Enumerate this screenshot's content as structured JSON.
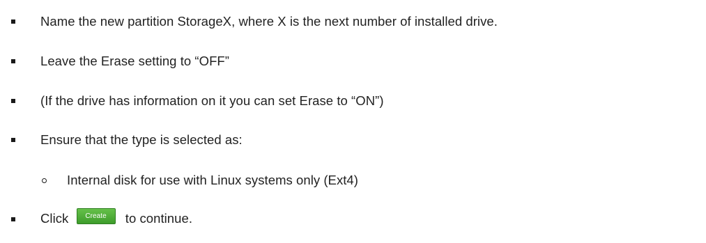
{
  "steps": [
    {
      "text": "Name the new partition StorageX, where X is the next number of installed drive."
    },
    {
      "text": "Leave the Erase setting to “OFF”"
    },
    {
      "text": "(If the drive has information on it you can set Erase to “ON”)"
    },
    {
      "text": "Ensure that the type is selected as:"
    }
  ],
  "sub_step": {
    "text": "Internal disk for use with Linux systems only (Ext4)"
  },
  "final_step": {
    "prefix": "Click",
    "button_label": "Create",
    "suffix": "to continue."
  }
}
